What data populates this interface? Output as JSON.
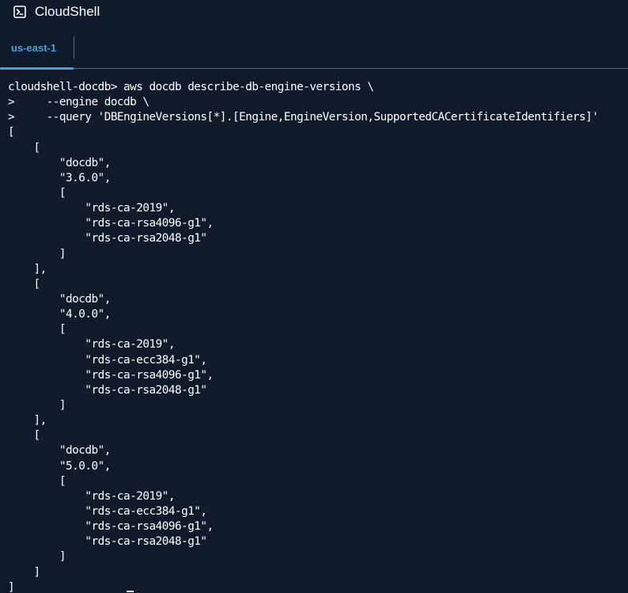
{
  "window": {
    "title": "CloudShell",
    "icon": "terminal-prompt-icon"
  },
  "tabs": [
    {
      "label": "us-east-1",
      "active": true
    }
  ],
  "colors": {
    "background": "#0f1b2a",
    "accent": "#41a4de",
    "text": "#ffffff",
    "divider": "#5f6b7a"
  },
  "terminal": {
    "lines": [
      "cloudshell-docdb> aws docdb describe-db-engine-versions \\",
      ">     --engine docdb \\",
      ">     --query 'DBEngineVersions[*].[Engine,EngineVersion,SupportedCACertificateIdentifiers]'",
      "[",
      "    [",
      "        \"docdb\",",
      "        \"3.6.0\",",
      "        [",
      "            \"rds-ca-2019\",",
      "            \"rds-ca-rsa4096-g1\",",
      "            \"rds-ca-rsa2048-g1\"",
      "        ]",
      "    ],",
      "    [",
      "        \"docdb\",",
      "        \"4.0.0\",",
      "        [",
      "            \"rds-ca-2019\",",
      "            \"rds-ca-ecc384-g1\",",
      "            \"rds-ca-rsa4096-g1\",",
      "            \"rds-ca-rsa2048-g1\"",
      "        ]",
      "    ],",
      "    [",
      "        \"docdb\",",
      "        \"5.0.0\",",
      "        [",
      "            \"rds-ca-2019\",",
      "            \"rds-ca-ecc384-g1\",",
      "            \"rds-ca-rsa4096-g1\",",
      "            \"rds-ca-rsa2048-g1\"",
      "        ]",
      "    ]",
      "]"
    ]
  }
}
